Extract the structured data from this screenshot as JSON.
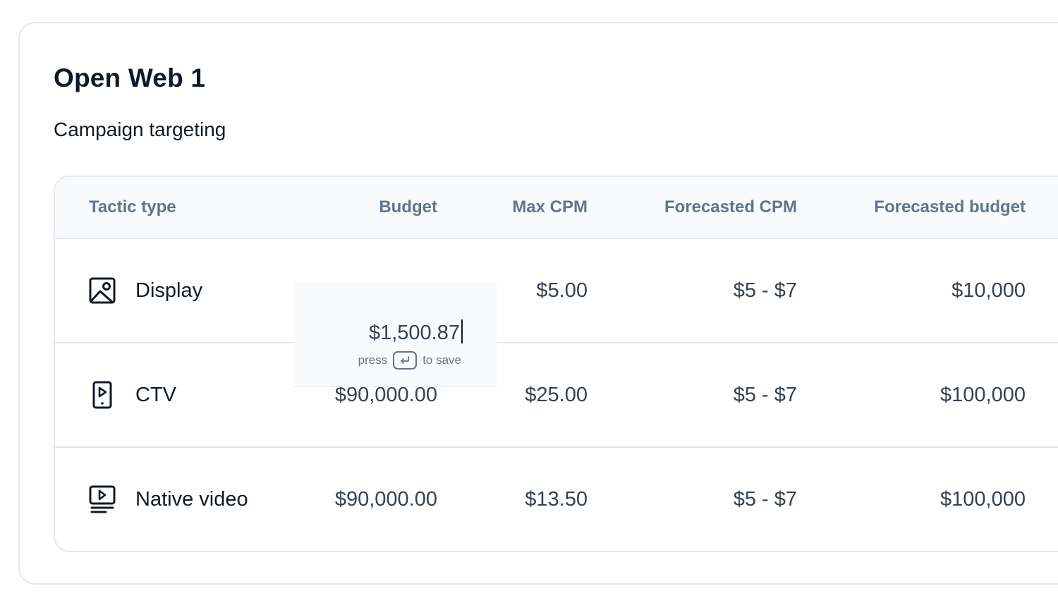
{
  "card": {
    "title": "Open Web 1",
    "subtitle": "Campaign targeting"
  },
  "table": {
    "columns": {
      "tactic_type": "Tactic type",
      "budget": "Budget",
      "max_cpm": "Max CPM",
      "forecasted_cpm": "Forecasted CPM",
      "forecasted_budget": "Forecasted budget"
    },
    "rows": [
      {
        "tactic": "Display",
        "icon": "image-icon",
        "budget": "",
        "max_cpm": "$5.00",
        "forecasted_cpm": "$5 - $7",
        "forecasted_budget": "$10,000"
      },
      {
        "tactic": "CTV",
        "icon": "ctv-play-icon",
        "budget": "$90,000.00",
        "max_cpm": "$25.00",
        "forecasted_cpm": "$5 - $7",
        "forecasted_budget": "$100,000"
      },
      {
        "tactic": "Native video",
        "icon": "video-list-icon",
        "budget": "$90,000.00",
        "max_cpm": "$13.50",
        "forecasted_cpm": "$5 - $7",
        "forecasted_budget": "$100,000"
      }
    ]
  },
  "editor": {
    "value": "$1,500.87",
    "hint_before": "press",
    "hint_after": "to save",
    "key_icon": "enter-key-icon"
  },
  "colors": {
    "text_primary": "#111827",
    "text_secondary": "#374151",
    "header_text": "#64748b",
    "border": "#e5e7eb",
    "header_bg": "#f8fafc"
  }
}
